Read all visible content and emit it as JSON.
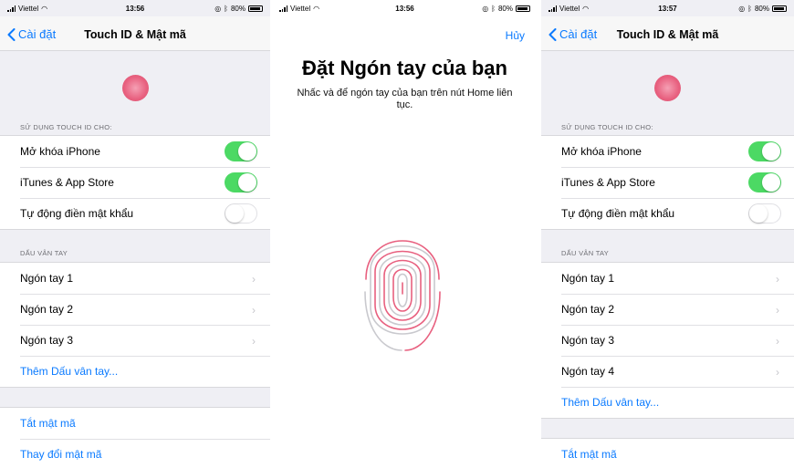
{
  "screen1": {
    "status": {
      "carrier": "Viettel",
      "time": "13:56",
      "battery": "80%"
    },
    "nav": {
      "back": "Cài đặt",
      "title": "Touch ID & Mật mã"
    },
    "use_header": "SỬ DỤNG TOUCH ID CHO:",
    "toggles": [
      {
        "label": "Mở khóa iPhone",
        "on": true
      },
      {
        "label": "iTunes & App Store",
        "on": true
      },
      {
        "label": "Tự động điền mật khẩu",
        "on": false
      }
    ],
    "fingerprint_header": "DẤU VÂN TAY",
    "fingers": [
      "Ngón tay 1",
      "Ngón tay 2",
      "Ngón tay 3"
    ],
    "add_fingerprint": "Thêm Dấu vân tay...",
    "passcode": [
      "Tắt mật mã",
      "Thay đổi mật mã"
    ]
  },
  "screen2": {
    "status": {
      "carrier": "Viettel",
      "time": "13:56",
      "battery": "80%"
    },
    "cancel": "Hủy",
    "title": "Đặt Ngón tay của bạn",
    "subtitle": "Nhấc và để ngón tay của bạn trên nút Home liên tục."
  },
  "screen3": {
    "status": {
      "carrier": "Viettel",
      "time": "13:57",
      "battery": "80%"
    },
    "nav": {
      "back": "Cài đặt",
      "title": "Touch ID & Mật mã"
    },
    "use_header": "SỬ DỤNG TOUCH ID CHO:",
    "toggles": [
      {
        "label": "Mở khóa iPhone",
        "on": true
      },
      {
        "label": "iTunes & App Store",
        "on": true
      },
      {
        "label": "Tự động điền mật khẩu",
        "on": false
      }
    ],
    "fingerprint_header": "DẤU VÂN TAY",
    "fingers": [
      "Ngón tay 1",
      "Ngón tay 2",
      "Ngón tay 3",
      "Ngón tay 4"
    ],
    "add_fingerprint": "Thêm Dấu vân tay...",
    "passcode": [
      "Tắt mật mã"
    ]
  },
  "colors": {
    "accent": "#0a7aff",
    "toggle_on": "#4cd964",
    "fingerprint": "#e8607f"
  }
}
